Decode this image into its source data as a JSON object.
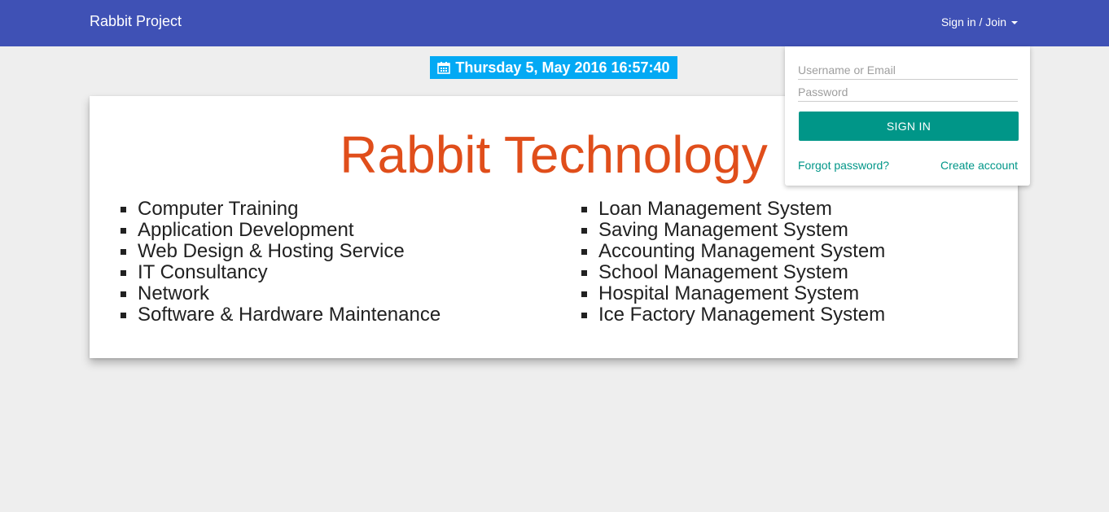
{
  "navbar": {
    "brand": "Rabbit Project",
    "signin_label": "Sign in / Join"
  },
  "datebar": {
    "icon": "calendar-icon",
    "text": "Thursday 5, May 2016 16:57:40"
  },
  "card": {
    "title": "Rabbit Technology",
    "services_left": [
      "Computer Training",
      "Application Development",
      "Web Design & Hosting Service",
      "IT Consultancy",
      "Network",
      "Software & Hardware Maintenance"
    ],
    "services_right": [
      "Loan Management System",
      "Saving Management System",
      "Accounting Management System",
      "School Management System",
      "Hospital Management System",
      "Ice Factory Management System"
    ]
  },
  "login": {
    "username_placeholder": "Username or Email",
    "password_placeholder": "Password",
    "signin_button": "SIGN IN",
    "forgot_link": "Forgot password?",
    "create_link": "Create account"
  },
  "colors": {
    "navbar": "#3f51b5",
    "date_badge": "#03a9f4",
    "title": "#e04e1b",
    "accent": "#009688"
  }
}
